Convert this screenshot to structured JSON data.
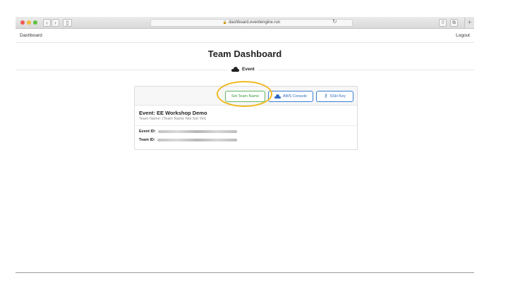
{
  "browser": {
    "url": "dashboard.eventengine.run",
    "icons": [
      "back-icon",
      "forward-icon",
      "sidebar-icon",
      "lock-icon",
      "reload-icon",
      "share-icon",
      "tabs-icon",
      "new-tab-icon"
    ]
  },
  "nav": {
    "brand": "Dashboard",
    "logout": "Logout"
  },
  "page": {
    "title": "Team Dashboard",
    "section_label": "Event"
  },
  "card": {
    "buttons": {
      "set_team_name": "Set Team Name",
      "aws_console": "AWS Console",
      "ssh_key": "SSH Key"
    },
    "event_name": "Event: EE Workshop Demo",
    "team_name": "Team Name: (Team Name Not Set Yet)",
    "event_id_label": "Event ID:",
    "team_id_label": "Team ID:"
  },
  "colors": {
    "highlight": "#f0b922",
    "green_button": "#3d9a3f",
    "blue_button": "#2d6cc0"
  }
}
